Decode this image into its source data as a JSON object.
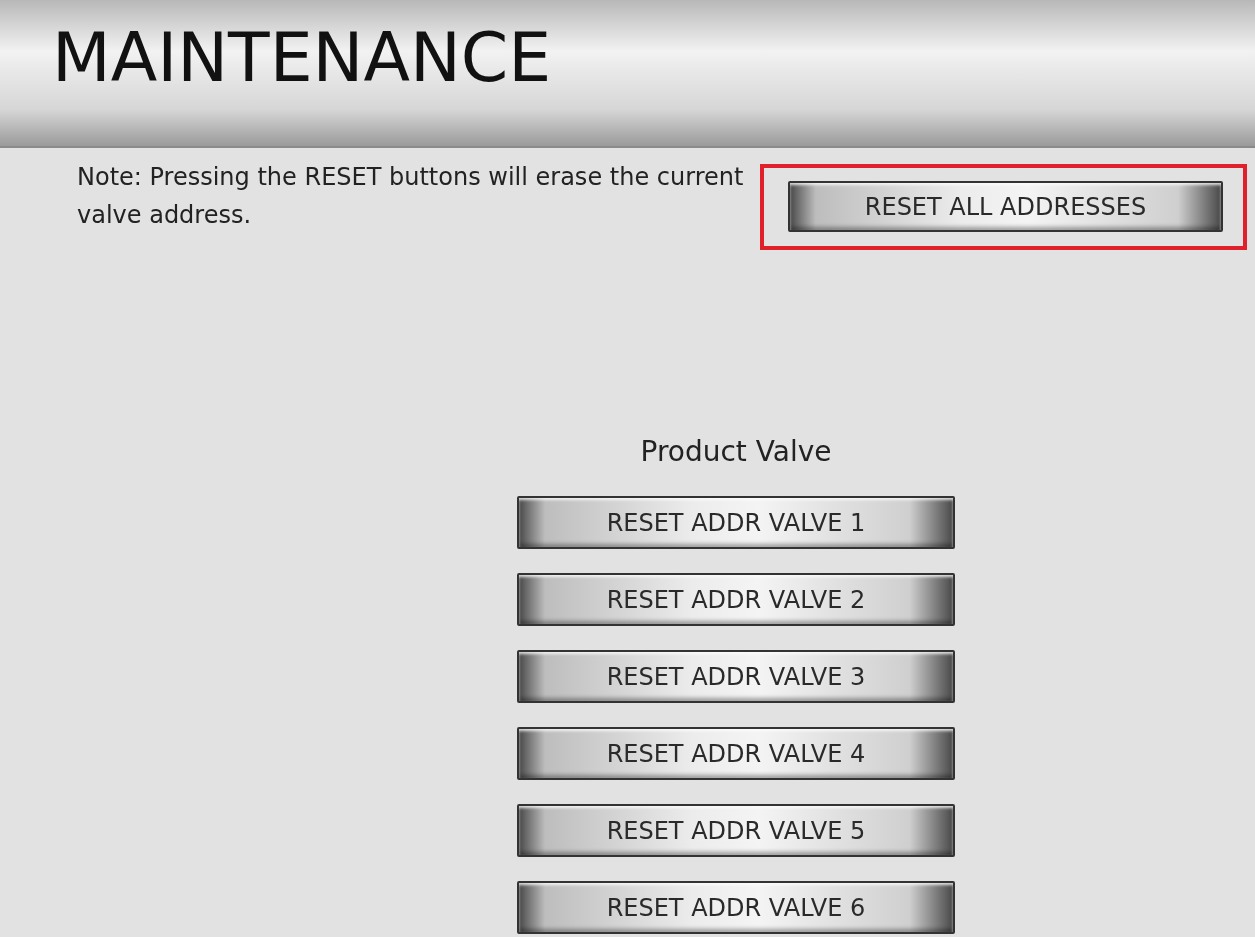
{
  "header": {
    "title": "MAINTENANCE"
  },
  "note": "Note: Pressing the RESET buttons will erase the current valve address.",
  "reset_all": {
    "label": "RESET ALL ADDRESSES",
    "highlighted": true
  },
  "product_valve": {
    "title": "Product Valve",
    "buttons": [
      {
        "label": "RESET ADDR VALVE 1"
      },
      {
        "label": "RESET ADDR VALVE 2"
      },
      {
        "label": "RESET ADDR VALVE 3"
      },
      {
        "label": "RESET ADDR VALVE 4"
      },
      {
        "label": "RESET ADDR VALVE 5"
      },
      {
        "label": "RESET ADDR VALVE 6"
      }
    ]
  }
}
